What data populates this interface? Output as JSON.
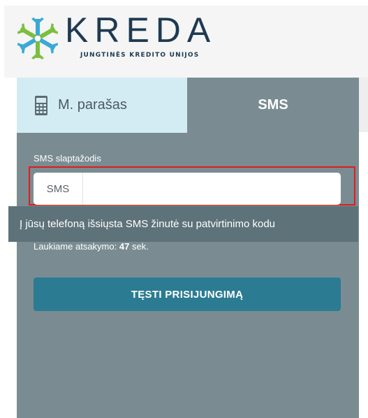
{
  "brand": {
    "name": "KREDA",
    "subtitle": "JUNGTINĖS KREDITO UNIJOS",
    "colors": {
      "navy": "#1f3a52",
      "green": "#7bbf3e",
      "blue": "#3aa9d6"
    }
  },
  "tabs": [
    {
      "label": "M. parašas",
      "icon": "mobile-phone-icon",
      "active": false
    },
    {
      "label": "SMS",
      "active": true
    }
  ],
  "sms_form": {
    "field_label": "SMS slaptažodis",
    "addon": "SMS",
    "input_value": "",
    "tooltip": "Į jūsų telefoną išsiųsta SMS žinutė su patvirtinimo kodu",
    "waiting_prefix": "Laukiame atsakymo:",
    "waiting_seconds": "47",
    "waiting_suffix": "sek.",
    "continue_label": "TĘSTI PRISIJUNGIMĄ"
  },
  "colors": {
    "panel": "#7a8c92",
    "tab_inactive": "#d3ecf4",
    "button": "#2b7b92",
    "highlight": "#e21b1b"
  }
}
